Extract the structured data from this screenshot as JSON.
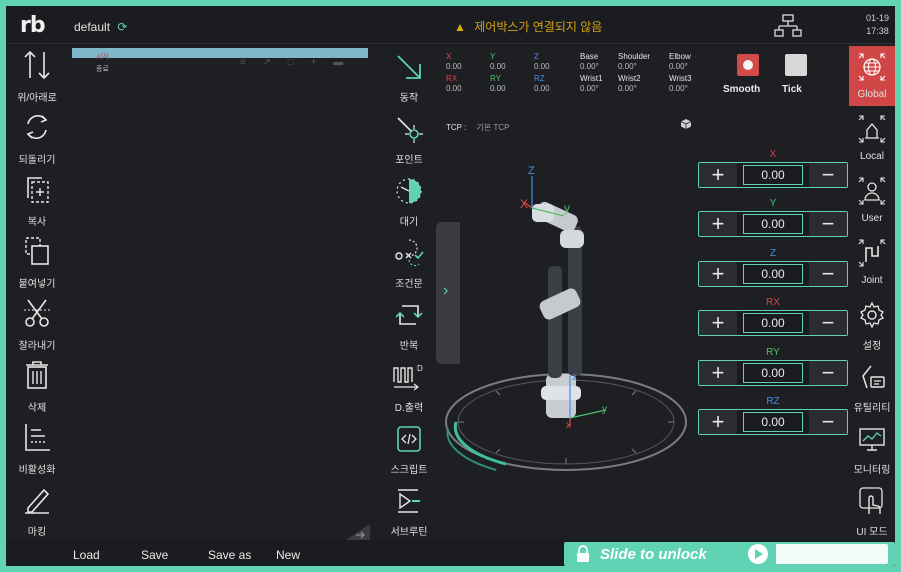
{
  "header": {
    "logo": "rb",
    "project_name": "default",
    "warning_text": "제어박스가 연결되지 않음",
    "date": "01-19",
    "time": "17:38"
  },
  "left_sidebar": [
    {
      "label": "위/아래로",
      "icon": "move-up-down-icon"
    },
    {
      "label": "되돌리기",
      "icon": "undo-icon"
    },
    {
      "label": "복사",
      "icon": "copy-icon"
    },
    {
      "label": "붙여넣기",
      "icon": "paste-icon"
    },
    {
      "label": "잘라내기",
      "icon": "scissors-icon"
    },
    {
      "label": "삭제",
      "icon": "trash-icon"
    },
    {
      "label": "비활성화",
      "icon": "deactivate-icon"
    },
    {
      "label": "마킹",
      "icon": "marker-icon"
    }
  ],
  "program_tree": {
    "start_label": "시작",
    "end_label": "종료"
  },
  "commands": [
    {
      "label": "동작",
      "icon": "move-arrow-icon"
    },
    {
      "label": "포인트",
      "icon": "point-icon"
    },
    {
      "label": "대기",
      "icon": "wait-icon"
    },
    {
      "label": "조건문",
      "icon": "condition-icon"
    },
    {
      "label": "반복",
      "icon": "repeat-icon"
    },
    {
      "label": "D.출력",
      "icon": "digital-output-icon"
    },
    {
      "label": "스크립트",
      "icon": "script-icon"
    },
    {
      "label": "서브루틴",
      "icon": "subroutine-icon"
    }
  ],
  "pose": {
    "x": {
      "label": "X",
      "value": "0.00"
    },
    "y": {
      "label": "Y",
      "value": "0.00"
    },
    "z": {
      "label": "Z",
      "value": "0.00"
    },
    "rx": {
      "label": "RX",
      "value": "0.00"
    },
    "ry": {
      "label": "RY",
      "value": "0.00"
    },
    "rz": {
      "label": "RZ",
      "value": "0.00"
    }
  },
  "joints": {
    "base": {
      "label": "Base",
      "value": "0.00°"
    },
    "shoulder": {
      "label": "Shoulder",
      "value": "0.00°"
    },
    "elbow": {
      "label": "Elbow",
      "value": "0.00°"
    },
    "wrist1": {
      "label": "Wrist1",
      "value": "0.00°"
    },
    "wrist2": {
      "label": "Wrist2",
      "value": "0.00°"
    },
    "wrist3": {
      "label": "Wrist3",
      "value": "0.00°"
    }
  },
  "motion_options": {
    "smooth_label": "Smooth",
    "tick_label": "Tick"
  },
  "tcp": {
    "label": "TCP :",
    "value": "기본 TCP"
  },
  "scene_axes": {
    "upper_z": "Z",
    "upper_x": "X",
    "upper_y": "y",
    "base_z": "z",
    "base_x": "x",
    "base_y": "y"
  },
  "jog": [
    {
      "axis": "X",
      "value": "0.00",
      "color": "#d34545"
    },
    {
      "axis": "Y",
      "value": "0.00",
      "color": "#4cc36a"
    },
    {
      "axis": "Z",
      "value": "0.00",
      "color": "#4a8fe0"
    },
    {
      "axis": "RX",
      "value": "0.00",
      "color": "#d34545"
    },
    {
      "axis": "RY",
      "value": "0.00",
      "color": "#4cc36a"
    },
    {
      "axis": "RZ",
      "value": "0.00",
      "color": "#4a8fe0"
    }
  ],
  "right_sidebar": [
    {
      "label": "Global",
      "icon": "globe-icon",
      "active": true
    },
    {
      "label": "Local",
      "icon": "robot-frame-icon"
    },
    {
      "label": "User",
      "icon": "user-frame-icon"
    },
    {
      "label": "Joint",
      "icon": "joint-icon"
    },
    {
      "label": "설정",
      "icon": "gear-icon"
    },
    {
      "label": "유틸리티",
      "icon": "utility-icon"
    },
    {
      "label": "모니터링",
      "icon": "monitor-icon"
    },
    {
      "label": "UI 모드",
      "icon": "touch-icon"
    }
  ],
  "footer": {
    "load": "Load",
    "save": "Save",
    "save_as": "Save as",
    "new": "New",
    "unlock_text": "Slide to unlock"
  },
  "colors": {
    "accent": "#5fd3b3",
    "active_red": "#d04545",
    "warning": "#d4a017"
  }
}
